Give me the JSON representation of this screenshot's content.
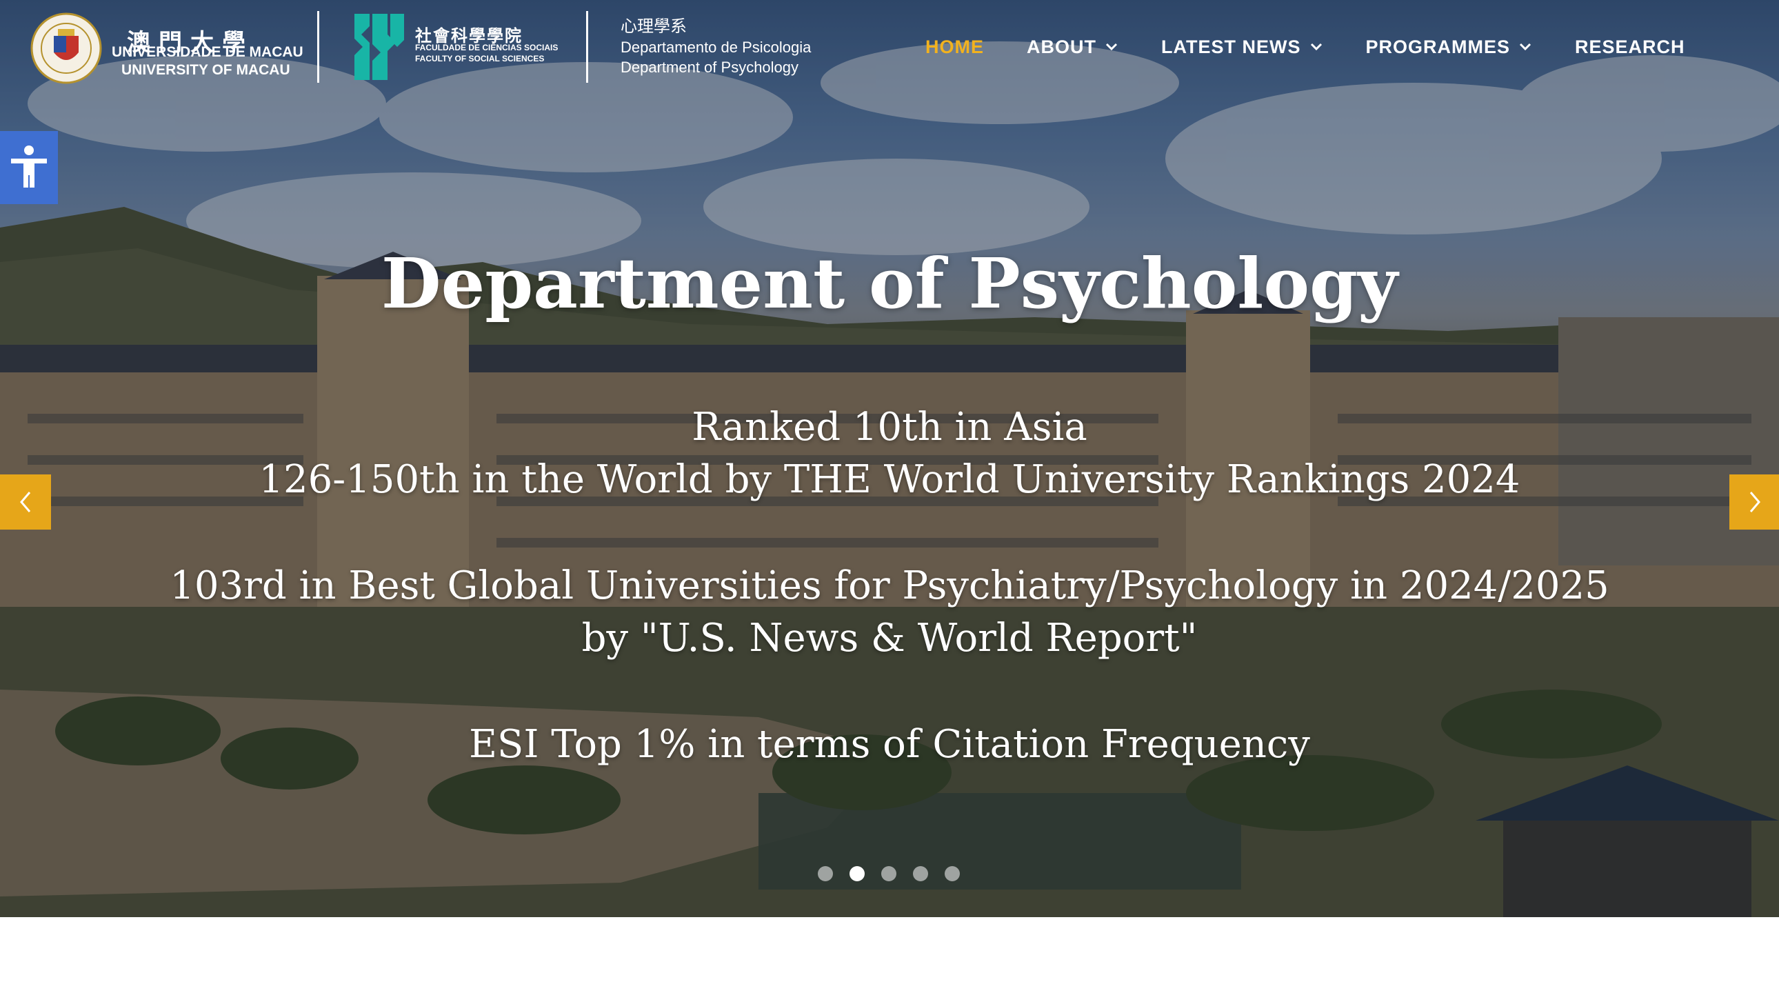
{
  "header": {
    "um_logo": {
      "chinese_name": "澳門大學",
      "portuguese_name": "UNIVERSIDADE DE MACAU",
      "english_name": "UNIVERSITY OF MACAU",
      "seal_text": "UNIVERSIDADE DE MACAU · 澳門大學"
    },
    "fss_logo": {
      "chinese_name": "社會科學學院",
      "portuguese_name": "FACULDADE DE CIÊNCIAS SOCIAIS",
      "english_name": "FACULTY OF SOCIAL SCIENCES",
      "accent_color": "#18b5a6"
    },
    "department": {
      "chinese_name": "心理學系",
      "portuguese_name": "Departamento de Psicologia",
      "english_name": "Department of Psychology"
    }
  },
  "nav": {
    "active_color": "#f2b21e",
    "items": [
      {
        "label": "HOME",
        "active": true,
        "has_dropdown": false
      },
      {
        "label": "ABOUT",
        "active": false,
        "has_dropdown": true
      },
      {
        "label": "LATEST NEWS",
        "active": false,
        "has_dropdown": true
      },
      {
        "label": "PROGRAMMES",
        "active": false,
        "has_dropdown": true
      },
      {
        "label": "RESEARCH",
        "active": false,
        "has_dropdown": false
      }
    ]
  },
  "accessibility": {
    "icon": "accessibility-icon",
    "color": "#3f6fd1"
  },
  "hero": {
    "title": "Department of Psychology",
    "lines": [
      "Ranked 10th in Asia",
      "126-150th in the World by THE World University Rankings 2024",
      "103rd in Best Global Universities for Psychiatry/Psychology in 2024/2025",
      "by \"U.S. News & World Report\"",
      "ESI Top 1% in terms of Citation Frequency"
    ]
  },
  "carousel": {
    "arrow_color": "#e6a619",
    "prev_icon": "chevron-left-icon",
    "next_icon": "chevron-right-icon",
    "slide_count": 5,
    "active_index": 1
  }
}
